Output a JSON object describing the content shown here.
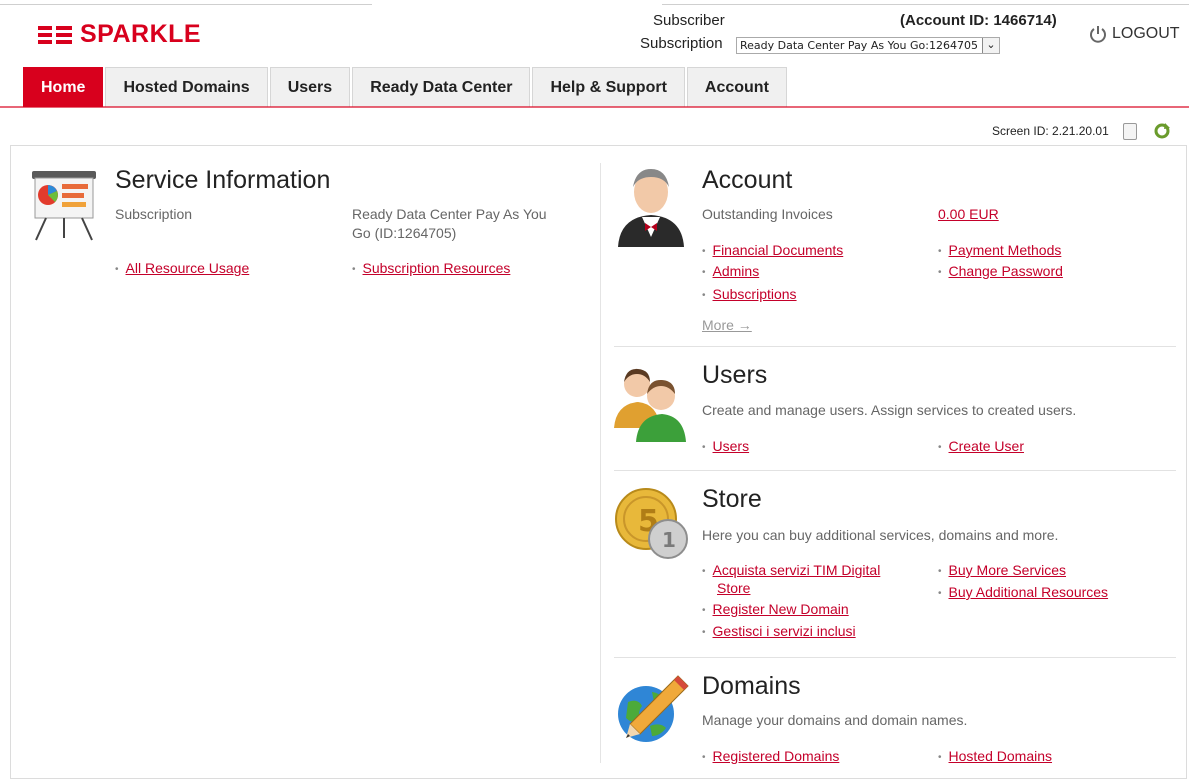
{
  "header": {
    "logo_text": "SPARKLE",
    "subscriber_label": "Subscriber",
    "subscription_label": "Subscription",
    "subscription_value": "Ready Data Center Pay As You Go:1264705",
    "account_id": "(Account ID: 1466714)",
    "logout_label": "LOGOUT"
  },
  "tabs": [
    {
      "label": "Home",
      "active": true
    },
    {
      "label": "Hosted Domains"
    },
    {
      "label": "Users"
    },
    {
      "label": "Ready Data Center"
    },
    {
      "label": "Help & Support"
    },
    {
      "label": "Account"
    }
  ],
  "screen_id": {
    "label": "Screen ID:",
    "value": "2.21.20.01"
  },
  "service_info": {
    "title": "Service Information",
    "subscription_label": "Subscription",
    "subscription_value_1": "Ready Data Center Pay As You",
    "subscription_value_2": "Go (ID:1264705)",
    "link_all_usage": "All Resource Usage",
    "link_sub_resources": "Subscription Resources"
  },
  "account": {
    "title": "Account",
    "invoices_label": "Outstanding Invoices",
    "invoices_value": "0.00 EUR",
    "links_left": [
      "Financial Documents",
      "Admins",
      "Subscriptions"
    ],
    "links_right": [
      "Payment Methods",
      "Change Password"
    ],
    "more_label": "More →"
  },
  "users": {
    "title": "Users",
    "description": "Create and manage users. Assign services to created users.",
    "link_users": "Users",
    "link_create": "Create User"
  },
  "store": {
    "title": "Store",
    "description": "Here you can buy additional services, domains and more.",
    "link_tim_1": "Acquista servizi TIM Digital",
    "link_tim_2": "Store",
    "link_register": "Register New Domain",
    "link_gestisci": "Gestisci i servizi inclusi",
    "link_buy_services": "Buy More Services",
    "link_buy_resources": "Buy Additional Resources"
  },
  "domains": {
    "title": "Domains",
    "description": "Manage your domains and domain names.",
    "link_registered": "Registered Domains",
    "link_hosted": "Hosted Domains"
  },
  "colors": {
    "brand": "#d8001d",
    "link": "#c4002a"
  }
}
